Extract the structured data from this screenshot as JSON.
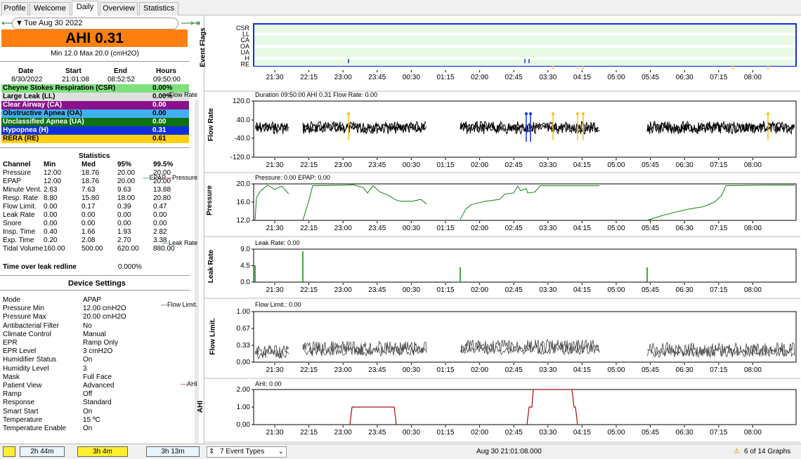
{
  "tabs": [
    "Profile",
    "Welcome",
    "Daily",
    "Overview",
    "Statistics"
  ],
  "date": {
    "label": "Tue Aug 30 2022",
    "prev": "⟵",
    "next": "⟶",
    "last": "⇥"
  },
  "ahi": {
    "label": "AHI 0.31",
    "minmax": "Min 12.0 Max 20.0 (cmH2O)"
  },
  "session": {
    "headers": [
      "Date",
      "Start",
      "End",
      "Hours"
    ],
    "values": [
      "8/30/2022",
      "21:01:08",
      "08:52:52",
      "09:50:00"
    ]
  },
  "events": [
    {
      "name": "Cheyne Stokes Respiration (CSR)",
      "value": "0.00%",
      "bg": "#80e080",
      "fg": "#000000"
    },
    {
      "name": "Large Leak (LL)",
      "value": "0.00%",
      "bg": "#e0e0e0",
      "fg": "#000000"
    },
    {
      "name": "Clear Airway (CA)",
      "value": "0.00",
      "bg": "#8b108b",
      "fg": "#ffffff"
    },
    {
      "name": "Obstructive Apnea (OA)",
      "value": "0.00",
      "bg": "#40b0f0",
      "fg": "#000000"
    },
    {
      "name": "Unclassified Apnea (UA)",
      "value": "0.00",
      "bg": "#107010",
      "fg": "#ffffff"
    },
    {
      "name": "Hypopnea (H)",
      "value": "0.31",
      "bg": "#1030e0",
      "fg": "#ffffff"
    },
    {
      "name": "RERA (RE)",
      "value": "0.61",
      "bg": "#ffd010",
      "fg": "#000000"
    }
  ],
  "stats": {
    "title": "Statistics",
    "headers": [
      "Channel",
      "Min",
      "Med",
      "95%",
      "99.5%"
    ],
    "rows": [
      [
        "Pressure",
        "12.00",
        "18.76",
        "20.00",
        "20.00"
      ],
      [
        "EPAP",
        "12.00",
        "18.76",
        "20.00",
        "20.00"
      ],
      [
        "Minute Vent.",
        "2.63",
        "7.63",
        "9.63",
        "13.88"
      ],
      [
        "Resp. Rate",
        "8.80",
        "15.80",
        "18.00",
        "20.80"
      ],
      [
        "Flow Limit.",
        "0.00",
        "0.17",
        "0.39",
        "0.47"
      ],
      [
        "Leak Rate",
        "0.00",
        "0.00",
        "0.00",
        "0.00"
      ],
      [
        "Snore",
        "0.00",
        "0.00",
        "0.00",
        "0.00"
      ],
      [
        "Insp. Time",
        "0.40",
        "1.66",
        "1.93",
        "2.82"
      ],
      [
        "Exp. Time",
        "0.20",
        "2.08",
        "2.70",
        "3.38"
      ],
      [
        "Tidal Volume",
        "160.00",
        "500.00",
        "620.00",
        "880.00"
      ]
    ],
    "leak_label": "Time over leak redline",
    "leak_value": "0.000%"
  },
  "device": {
    "title": "Device Settings",
    "rows": [
      [
        "Mode",
        "APAP"
      ],
      [
        "Pressure Min",
        "12.00 cmH2O"
      ],
      [
        "Pressure Max",
        "20.00 cmH2O"
      ],
      [
        "Antibacterial Filter",
        "No"
      ],
      [
        "Climate Control",
        "Manual"
      ],
      [
        "EPR",
        "Ramp Only"
      ],
      [
        "EPR Level",
        "3 cmH2O"
      ],
      [
        "Humidifier Status",
        "On"
      ],
      [
        "Humidity Level",
        "3"
      ],
      [
        "Mask",
        "Full Face"
      ],
      [
        "Patient View",
        "Advanced"
      ],
      [
        "Ramp",
        "Off"
      ],
      [
        "Response",
        "Standard"
      ],
      [
        "Smart Start",
        "On"
      ],
      [
        "Temperature",
        "15 ºC"
      ],
      [
        "Temperature Enable",
        "On"
      ]
    ]
  },
  "bottom_left": {
    "b1": "2h 44m",
    "b2": "3h 4m",
    "b3": "3h 13m"
  },
  "time_ticks": [
    "21:30",
    "22:15",
    "23:00",
    "23:45",
    "00:30",
    "01:15",
    "02:00",
    "02:45",
    "03:30",
    "04:15",
    "05:00",
    "05:45",
    "06:30",
    "07:15",
    "08:00"
  ],
  "graphs": {
    "flags": {
      "ylabel": "Event Flags",
      "rows": [
        "CSR",
        "LL",
        "CA",
        "OA",
        "UA",
        "H",
        "RE"
      ]
    },
    "flow": {
      "ylabel": "Flow Rate",
      "title": "Duration 09:50:00 AHI 0.31 Flow Rate: 0.00",
      "legend": "Flow Rate",
      "ticks": [
        "120.0",
        "40.0",
        "-40.0",
        "-120.0"
      ]
    },
    "pressure": {
      "ylabel": "Pressure",
      "title": "Pressure: 0.00 EPAP: 0.00",
      "legend1": "EPAP",
      "legend2": "Pressure",
      "ticks": [
        "20.0",
        "16.0",
        "12.0"
      ]
    },
    "leak": {
      "ylabel": "Leak Rate",
      "title": "Leak Rate: 0.00",
      "legend": "Leak Rate",
      "ticks": [
        "9.0",
        "4.5",
        "0.0"
      ]
    },
    "flowlim": {
      "ylabel": "Flow Limit.",
      "title": "Flow Limit.: 0.00",
      "legend": "Flow Limit.",
      "ticks": [
        "1.00",
        "0.67",
        "0.33",
        "0.00"
      ]
    },
    "ahi": {
      "ylabel": "AHI",
      "title": "AHI: 0.00",
      "legend": "AHI",
      "ticks": [
        "2.00",
        "1.00",
        "0.00"
      ]
    }
  },
  "bottom_right": {
    "events": "7 Event Types",
    "datetime": "Aug 30 21:01:08.000",
    "graphs": "6 of 14 Graphs"
  },
  "colors": {
    "ahi_box": "#ff8010",
    "flow": "#000000",
    "epap": "#108010",
    "leak": "#108010",
    "flowlim": "#404040",
    "ahi_line": "#a01010",
    "h_event": "#1030e0",
    "re_event": "#ffc010"
  }
}
